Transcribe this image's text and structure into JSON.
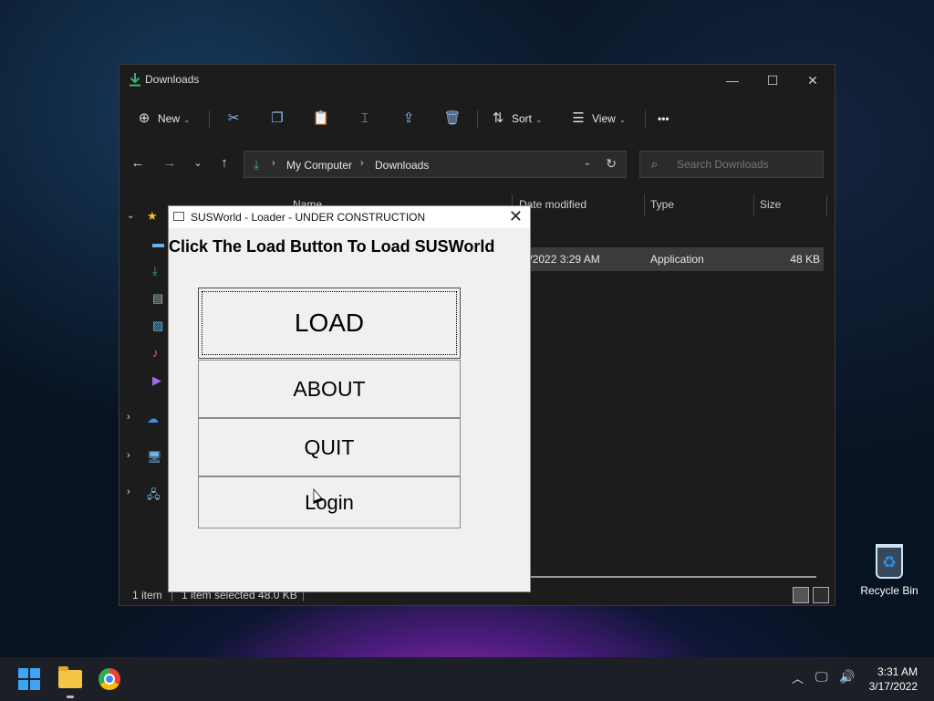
{
  "explorer": {
    "title": "Downloads",
    "toolbar": {
      "new_label": "New",
      "sort_label": "Sort",
      "view_label": "View",
      "more_label": "•••"
    },
    "address": {
      "crumbs": [
        "My Computer",
        "Downloads"
      ]
    },
    "search": {
      "placeholder": "Search Downloads"
    },
    "columns": {
      "name": "Name",
      "date": "Date modified",
      "type": "Type",
      "size": "Size"
    },
    "file_row": {
      "date": "3/17/2022 3:29 AM",
      "type": "Application",
      "size": "48 KB"
    },
    "status": {
      "count": "1 item",
      "selected": "1 item selected  48.0 KB"
    }
  },
  "loader": {
    "title": "SUSWorld - Loader - UNDER CONSTRUCTION",
    "headline": "Click The Load Button To Load SUSWorld",
    "buttons": {
      "load": "LOAD",
      "about": "ABOUT",
      "quit": "QUIT",
      "login": "Login"
    }
  },
  "desktop": {
    "recycle_bin_label": "Recycle Bin"
  },
  "taskbar": {
    "time": "3:31 AM",
    "date": "3/17/2022"
  },
  "colors": {
    "accent": "#3da5f4",
    "download_green": "#3bb273",
    "dialog_bg": "#f0f0f0"
  }
}
